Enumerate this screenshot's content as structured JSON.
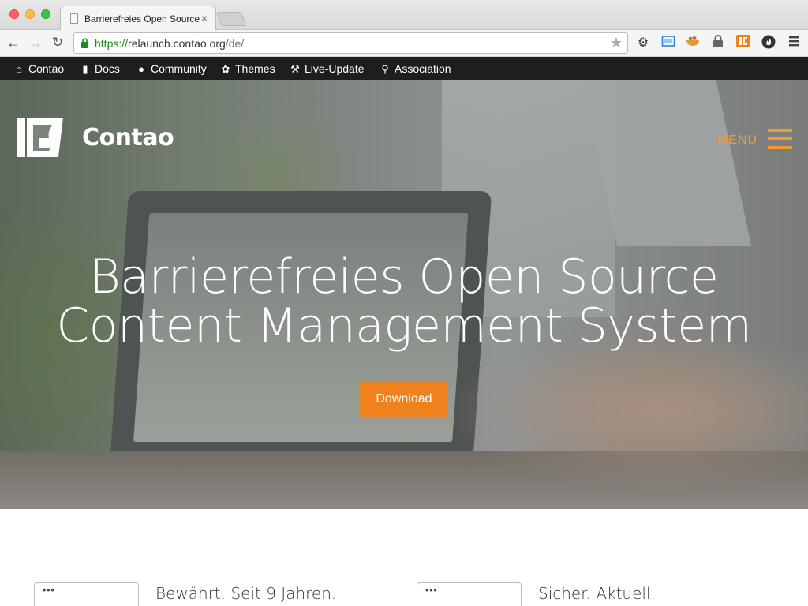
{
  "browser": {
    "tab_title": "Barrierefreies Open Source",
    "tab_close": "×",
    "url_scheme": "https://",
    "url_host": "relaunch.contao.org",
    "url_path": "/de/"
  },
  "sitebar": {
    "items": [
      {
        "label": "Contao",
        "icon": "home-icon"
      },
      {
        "label": "Docs",
        "icon": "book-icon"
      },
      {
        "label": "Community",
        "icon": "user-icon"
      },
      {
        "label": "Themes",
        "icon": "leaf-icon"
      },
      {
        "label": "Live-Update",
        "icon": "wrench-icon"
      },
      {
        "label": "Association",
        "icon": "map-marker-icon"
      }
    ]
  },
  "header": {
    "brand": "Contao",
    "menu_label": "MENU"
  },
  "hero": {
    "headline_line1": "Barrierefreies Open Source",
    "headline_line2": "Content Management System",
    "download_label": "Download"
  },
  "features": [
    {
      "title": "Bewährt. Seit 9 Jahren.",
      "dots": "•••"
    },
    {
      "title": "Sicher. Aktuell.",
      "dots": "•••"
    }
  ],
  "colors": {
    "accent": "#f0821e",
    "sitebar_bg": "#1e1e1e",
    "url_secure": "#1a8c1a"
  }
}
